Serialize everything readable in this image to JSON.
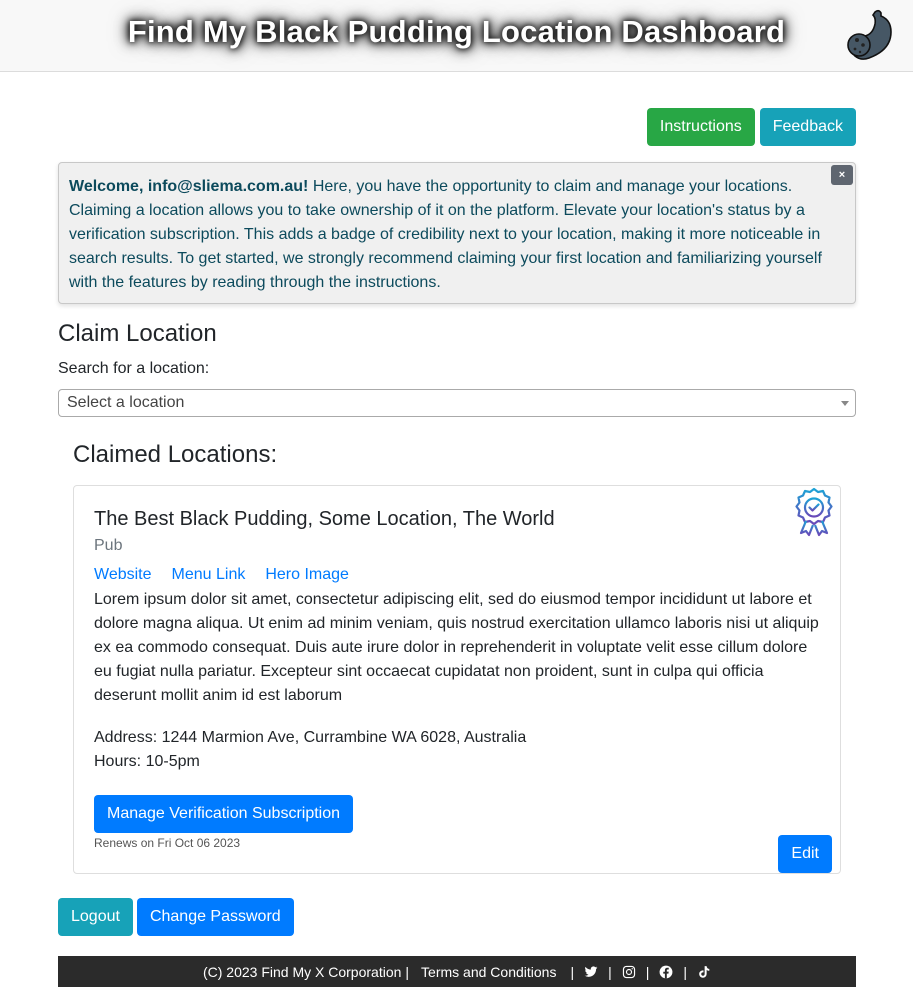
{
  "header": {
    "title": "Find My Black Pudding Location Dashboard",
    "logo_icon": "black-pudding-icon"
  },
  "top_buttons": {
    "instructions": "Instructions",
    "feedback": "Feedback"
  },
  "alert": {
    "greeting": "Welcome, info@sliema.com.au!",
    "message": " Here, you have the opportunity to claim and manage your locations. Claiming a location allows you to take ownership of it on the platform. Elevate your location's status by a verification subscription. This adds a badge of credibility next to your location, making it more noticeable in search results. To get started, we strongly recommend claiming your first location and familiarizing yourself with the features by reading through the instructions.",
    "close_label": "×"
  },
  "claim": {
    "title": "Claim Location",
    "search_label": "Search for a location:",
    "select_value": "Select a location"
  },
  "claimed": {
    "title": "Claimed Locations:",
    "locations": [
      {
        "name": "The Best Black Pudding, Some Location, The World",
        "type": "Pub",
        "links": [
          "Website",
          "Menu Link",
          "Hero Image"
        ],
        "description": "Lorem ipsum dolor sit amet, consectetur adipiscing elit, sed do eiusmod tempor incididunt ut labore et dolore magna aliqua. Ut enim ad minim veniam, quis nostrud exercitation ullamco laboris nisi ut aliquip ex ea commodo consequat. Duis aute irure dolor in reprehenderit in voluptate velit esse cillum dolore eu fugiat nulla pariatur. Excepteur sint occaecat cupidatat non proident, sunt in culpa qui officia deserunt mollit anim id est laborum",
        "address": "Address: 1244 Marmion Ave, Currambine WA 6028, Australia",
        "hours": "Hours: 10-5pm",
        "verified": true,
        "manage_button": "Manage Verification Subscription",
        "renews": "Renews on Fri Oct 06 2023",
        "edit_button": "Edit"
      }
    ]
  },
  "account": {
    "logout": "Logout",
    "change_password": "Change Password"
  },
  "footer": {
    "copyright": "(C) 2023 Find My X Corporation",
    "terms": "Terms and Conditions",
    "separator": "|",
    "social": [
      "twitter-icon",
      "instagram-icon",
      "facebook-icon",
      "tiktok-icon"
    ]
  },
  "colors": {
    "green": "#28a745",
    "teal": "#17a2b8",
    "blue": "#007bff",
    "footer_bg": "#2b2b2b",
    "alert_text": "#0c4a5c"
  }
}
